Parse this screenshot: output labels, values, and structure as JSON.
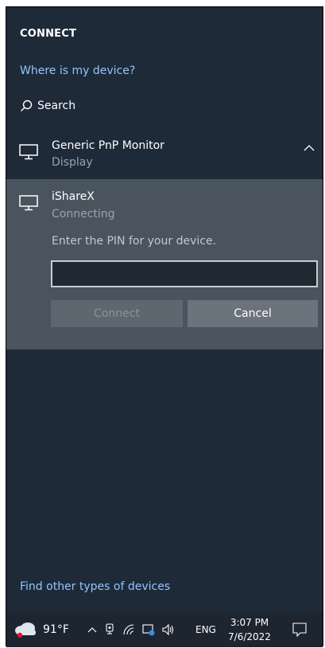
{
  "panel": {
    "title": "CONNECT",
    "where_link": "Where is my device?",
    "search_label": "Search",
    "find_link": "Find other types of devices"
  },
  "devices": [
    {
      "name": "Generic PnP Monitor",
      "status": "Display",
      "icon": "monitor-icon",
      "expanded": true
    },
    {
      "name": "iShareX",
      "status": "Connecting",
      "icon": "monitor-icon",
      "pin_prompt": "Enter the PIN for your device.",
      "pin_value": "",
      "connect_label": "Connect",
      "cancel_label": "Cancel"
    }
  ],
  "taskbar": {
    "weather_icon": "cloud-icon",
    "temperature": "91°F",
    "tray_icons": [
      "chevron-up-icon",
      "meet-now-icon",
      "wifi-icon",
      "pen-icon",
      "volume-icon"
    ],
    "language": "ENG",
    "time": "3:07 PM",
    "date": "7/6/2022",
    "notification_icon": "notification-icon"
  },
  "colors": {
    "background": "#1f2a38",
    "selected_device": "#4a545f",
    "link": "#8fc6ff",
    "accent_alert": "#e81123"
  }
}
